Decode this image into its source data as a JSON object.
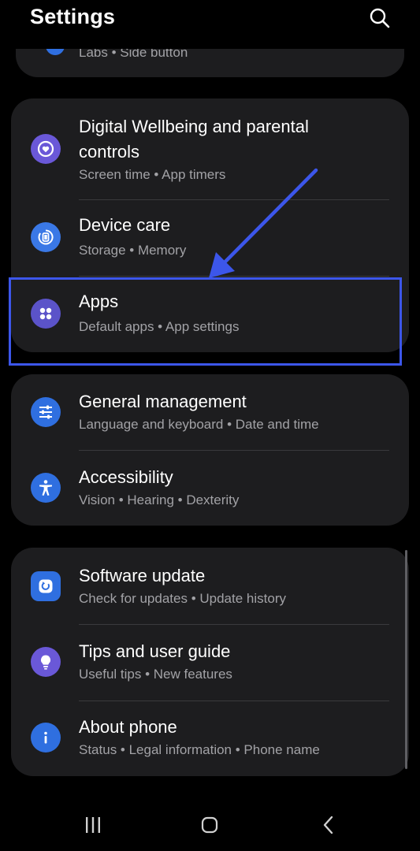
{
  "header": {
    "title": "Settings",
    "search_icon": "search-icon"
  },
  "top_card": {
    "subtitle": "Labs  •  Side button"
  },
  "groups": [
    {
      "items": [
        {
          "title_line1": "Digital Wellbeing and parental",
          "title_line2": "controls",
          "subtitle": "Screen time  •  App timers",
          "icon": "digital-wellbeing-icon",
          "icon_color": "#6a58d8"
        },
        {
          "title": "Device care",
          "subtitle": "Storage  •  Memory",
          "icon": "device-care-icon",
          "icon_color": "#3a78e6"
        },
        {
          "title": "Apps",
          "subtitle": "Default apps  •  App settings",
          "icon": "apps-icon",
          "icon_color": "#5b53c9"
        }
      ]
    },
    {
      "items": [
        {
          "title": "General management",
          "subtitle": "Language and keyboard  •  Date and time",
          "icon": "general-management-icon",
          "icon_color": "#2f6fe0"
        },
        {
          "title": "Accessibility",
          "subtitle": "Vision  •  Hearing  •  Dexterity",
          "icon": "accessibility-icon",
          "icon_color": "#2f6fe0"
        }
      ]
    },
    {
      "items": [
        {
          "title": "Software update",
          "subtitle": "Check for updates  •  Update history",
          "icon": "software-update-icon",
          "icon_color": "#2f6fe0"
        },
        {
          "title": "Tips and user guide",
          "subtitle": "Useful tips  •  New features",
          "icon": "tips-lightbulb-icon",
          "icon_color": "#6a58d8"
        },
        {
          "title": "About phone",
          "subtitle": "Status  •  Legal information  •  Phone name",
          "icon": "info-icon",
          "icon_color": "#2f6fe0"
        }
      ]
    }
  ],
  "annotation": {
    "highlight_color": "#3c56ea",
    "highlighted_item": "Apps"
  },
  "navbar": {
    "recents": "recent-apps-icon",
    "home": "home-icon",
    "back": "back-icon"
  }
}
